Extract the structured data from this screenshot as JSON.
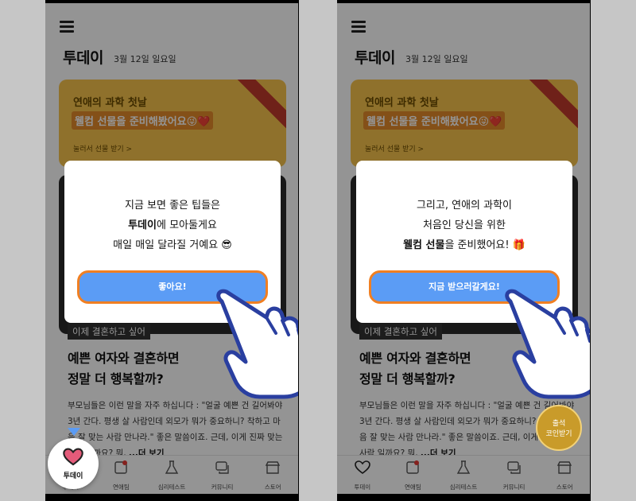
{
  "colors": {
    "accent": "#5b9cf5",
    "button_border": "#f07f22",
    "gift_card": "#f6c34c",
    "heart": "#e45b7a"
  },
  "left": {
    "header": {
      "menu_icon": "hamburger-icon",
      "title": "투데이",
      "date": "3월 12일 일요일"
    },
    "gift_card": {
      "title": "연애의 과학 첫날",
      "subtitle": "웰컴 선물을 준비해봤어요😜❤️",
      "link": "눌러서 선물 받기 >"
    },
    "article": {
      "tag": "이제 결혼하고 싶어",
      "title_line1": "예쁜 여자와 결혼하면",
      "title_line2": "정말 더 행복할까?",
      "body": "부모님들은 이런 말을 자주 하십니다 : \"얼굴 예쁜 건 길어봐야 3년 간다. 평생 살 사람인데 외모가 뭐가 중요하니? 착하고 마음 잘 맞는 사람 만나라.\" 좋은 말씀이죠. 근데, 이게 진짜 맞는 사람 일까요? 뭐,",
      "more": "...더 보기"
    },
    "modal": {
      "line1": "지금 보면 좋은 팁들은",
      "line2_bold": "투데이",
      "line2_rest": "에 모아둘게요",
      "line3": "매일 매일 달라질 거예요 😎",
      "button": "좋아요!"
    },
    "fab_label": "투데이",
    "nav": [
      "투데이",
      "연애팀",
      "심리테스트",
      "커뮤니티",
      "스토어"
    ]
  },
  "right": {
    "header": {
      "menu_icon": "hamburger-icon",
      "title": "투데이",
      "date": "3월 12일 일요일"
    },
    "gift_card": {
      "title": "연애의 과학 첫날",
      "subtitle": "웰컴 선물을 준비해봤어요😜❤️",
      "link": "눌러서 선물 받기 >"
    },
    "article": {
      "tag": "이제 결혼하고 싶어",
      "title_line1": "예쁜 여자와 결혼하면",
      "title_line2": "정말 더 행복할까?",
      "body": "부모님들은 이런 말을 자주 하십니다 : \"얼굴 예쁜 건 길어봐야 3년 간다. 평생 살 사람인데 외모가 뭐가 중요하니? 착하고 마음 잘 맞는 사람 만나라.\" 좋은 말씀이죠. 근데, 이게 진짜 맞는 사람 일까요? 뭐,",
      "more": "...더 보기"
    },
    "modal": {
      "line1": "그리고, 연애의 과학이",
      "line2": "처음인 당신을 위한",
      "line3_bold": "웰컴 선물",
      "line3_rest": "을 준비했어요! 🎁",
      "button": "지금 받으러갈게요!"
    },
    "coin_label_1": "출석",
    "coin_label_2": "코인받기",
    "nav": [
      "투데이",
      "연애팀",
      "심리테스트",
      "커뮤니티",
      "스토어"
    ]
  }
}
